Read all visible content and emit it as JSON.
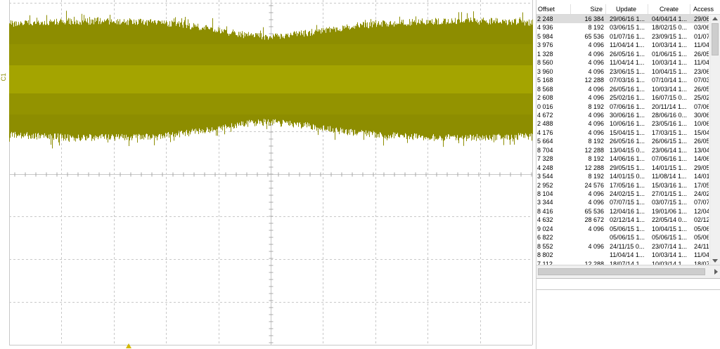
{
  "scope": {
    "trace_label": "C1",
    "trace_color": "#8d8d00",
    "trace_core_color": "#b4b400",
    "grid_color": "#c8c8c8",
    "trigger_marker": "trigger-arrow-icon"
  },
  "filelist": {
    "columns": [
      "Offset",
      "Size",
      "Update",
      "Create",
      "Access"
    ],
    "rows": [
      [
        "2 248",
        "16 384",
        "29/06/16 1...",
        "04/04/14 1...",
        "29/06..."
      ],
      [
        "4 936",
        "8 192",
        "03/06/15 1...",
        "18/02/15 0...",
        "03/06..."
      ],
      [
        "5 984",
        "65 536",
        "01/07/16 1...",
        "23/09/15 1...",
        "01/07..."
      ],
      [
        "3 976",
        "4 096",
        "11/04/14 1...",
        "10/03/14 1...",
        "11/04..."
      ],
      [
        "1 328",
        "4 096",
        "26/05/16 1...",
        "01/06/15 1...",
        "26/05..."
      ],
      [
        "8 560",
        "4 096",
        "11/04/14 1...",
        "10/03/14 1...",
        "11/04..."
      ],
      [
        "3 960",
        "4 096",
        "23/06/15 1...",
        "10/04/15 1...",
        "23/06..."
      ],
      [
        "5 168",
        "12 288",
        "07/03/16 1...",
        "07/10/14 1...",
        "07/03..."
      ],
      [
        "8 568",
        "4 096",
        "26/05/16 1...",
        "10/03/14 1...",
        "26/05..."
      ],
      [
        "2 608",
        "4 096",
        "25/02/16 1...",
        "16/07/15 0...",
        "25/02..."
      ],
      [
        "0 016",
        "8 192",
        "07/06/16 1...",
        "20/11/14 1...",
        "07/06..."
      ],
      [
        "4 672",
        "4 096",
        "30/06/16 1...",
        "28/06/16 0...",
        "30/06..."
      ],
      [
        "2 488",
        "4 096",
        "10/06/16 1...",
        "23/05/16 1...",
        "10/06..."
      ],
      [
        "4 176",
        "4 096",
        "15/04/15 1...",
        "17/03/15 1...",
        "15/04..."
      ],
      [
        "5 664",
        "8 192",
        "26/05/16 1...",
        "26/06/15 1...",
        "26/05..."
      ],
      [
        "8 704",
        "12 288",
        "13/04/15 0...",
        "23/06/14 1...",
        "13/04..."
      ],
      [
        "7 328",
        "8 192",
        "14/06/16 1...",
        "07/06/16 1...",
        "14/06..."
      ],
      [
        "4 248",
        "12 288",
        "29/05/15 1...",
        "14/01/15 1...",
        "29/05..."
      ],
      [
        "3 544",
        "8 192",
        "14/01/15 0...",
        "11/08/14 1...",
        "14/01..."
      ],
      [
        "2 952",
        "24 576",
        "17/05/16 1...",
        "15/03/16 1...",
        "17/05..."
      ],
      [
        "8 104",
        "4 096",
        "24/02/15 1...",
        "27/01/15 1...",
        "24/02..."
      ],
      [
        "3 344",
        "4 096",
        "07/07/15 1...",
        "03/07/15 1...",
        "07/07..."
      ],
      [
        "8 416",
        "65 536",
        "12/04/16 1...",
        "19/01/06 1...",
        "12/04..."
      ],
      [
        "4 632",
        "28 672",
        "02/12/14 1...",
        "22/05/14 0...",
        "02/12..."
      ],
      [
        "9 024",
        "4 096",
        "05/06/15 1...",
        "10/04/15 1...",
        "05/06..."
      ],
      [
        "6 822",
        "",
        "05/06/15 1...",
        "05/06/15 1...",
        "05/06..."
      ],
      [
        "8 552",
        "4 096",
        "24/11/15 0...",
        "23/07/14 1...",
        "24/11..."
      ],
      [
        "8 802",
        "",
        "11/04/14 1...",
        "10/03/14 1...",
        "11/04..."
      ],
      [
        "7 112",
        "12 288",
        "18/07/14 1...",
        "10/03/14 1...",
        "18/07..."
      ]
    ]
  }
}
